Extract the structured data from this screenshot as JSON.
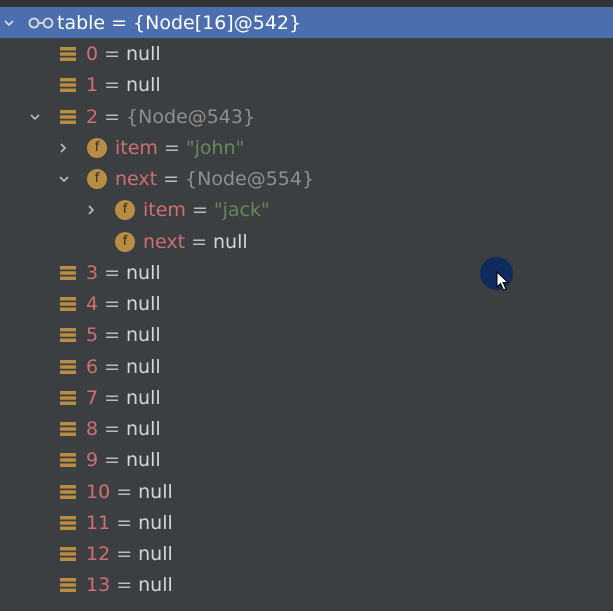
{
  "root": {
    "name": "table",
    "eq": "=",
    "value": "{Node[16]@542}",
    "icon": "watch-glasses-icon",
    "expanded": true
  },
  "rows": [
    {
      "name": "0",
      "eq": "=",
      "value": "null"
    },
    {
      "name": "1",
      "eq": "=",
      "value": "null"
    },
    {
      "name": "2",
      "eq": "=",
      "value": "{Node@543}",
      "expanded": true
    },
    {
      "name": "item",
      "eq": "=",
      "value": "\"john\""
    },
    {
      "name": "next",
      "eq": "=",
      "value": "{Node@554}",
      "expanded": true
    },
    {
      "name": "item",
      "eq": "=",
      "value": "\"jack\""
    },
    {
      "name": "next",
      "eq": "=",
      "value": "null"
    },
    {
      "name": "3",
      "eq": "=",
      "value": "null"
    },
    {
      "name": "4",
      "eq": "=",
      "value": "null"
    },
    {
      "name": "5",
      "eq": "=",
      "value": "null"
    },
    {
      "name": "6",
      "eq": "=",
      "value": "null"
    },
    {
      "name": "7",
      "eq": "=",
      "value": "null"
    },
    {
      "name": "8",
      "eq": "=",
      "value": "null"
    },
    {
      "name": "9",
      "eq": "=",
      "value": "null"
    },
    {
      "name": "10",
      "eq": "=",
      "value": "null"
    },
    {
      "name": "11",
      "eq": "=",
      "value": "null"
    },
    {
      "name": "12",
      "eq": "=",
      "value": "null"
    },
    {
      "name": "13",
      "eq": "=",
      "value": "null"
    }
  ],
  "field_icon_letter": "f",
  "colors": {
    "background": "#3c3f41",
    "selection": "#4b6eaf",
    "name": "#cf6e73",
    "string": "#6a8759",
    "array_icon": "#b88c42"
  }
}
